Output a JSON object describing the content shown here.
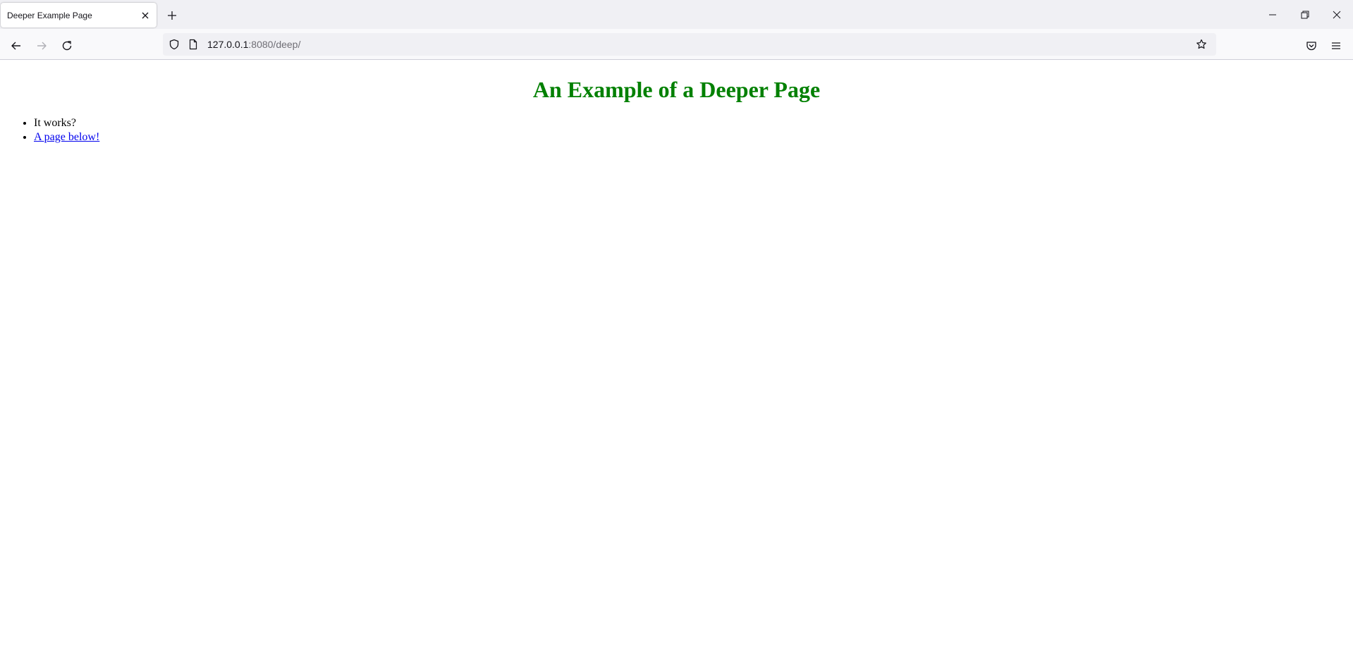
{
  "browser": {
    "tab": {
      "title": "Deeper Example Page"
    },
    "url": {
      "host": "127.0.0.1",
      "rest": ":8080/deep/"
    }
  },
  "page": {
    "heading": "An Example of a Deeper Page",
    "items": [
      {
        "text": "It works?",
        "is_link": false
      },
      {
        "text": "A page below!",
        "is_link": true
      }
    ]
  },
  "colors": {
    "heading": "#008000",
    "link": "#0000ee",
    "icon": "#15141a",
    "icon_disabled": "#b0b0b6"
  },
  "icons": {
    "tab_close": "close-icon",
    "new_tab": "plus-icon",
    "minimize": "minimize-icon",
    "restore": "restore-icon",
    "close_window": "close-icon",
    "back": "arrow-left-icon",
    "forward": "arrow-right-icon",
    "reload": "reload-icon",
    "tracking": "shield-icon",
    "page": "page-icon",
    "bookmark": "star-icon",
    "pocket": "pocket-icon",
    "menu": "hamburger-icon"
  }
}
